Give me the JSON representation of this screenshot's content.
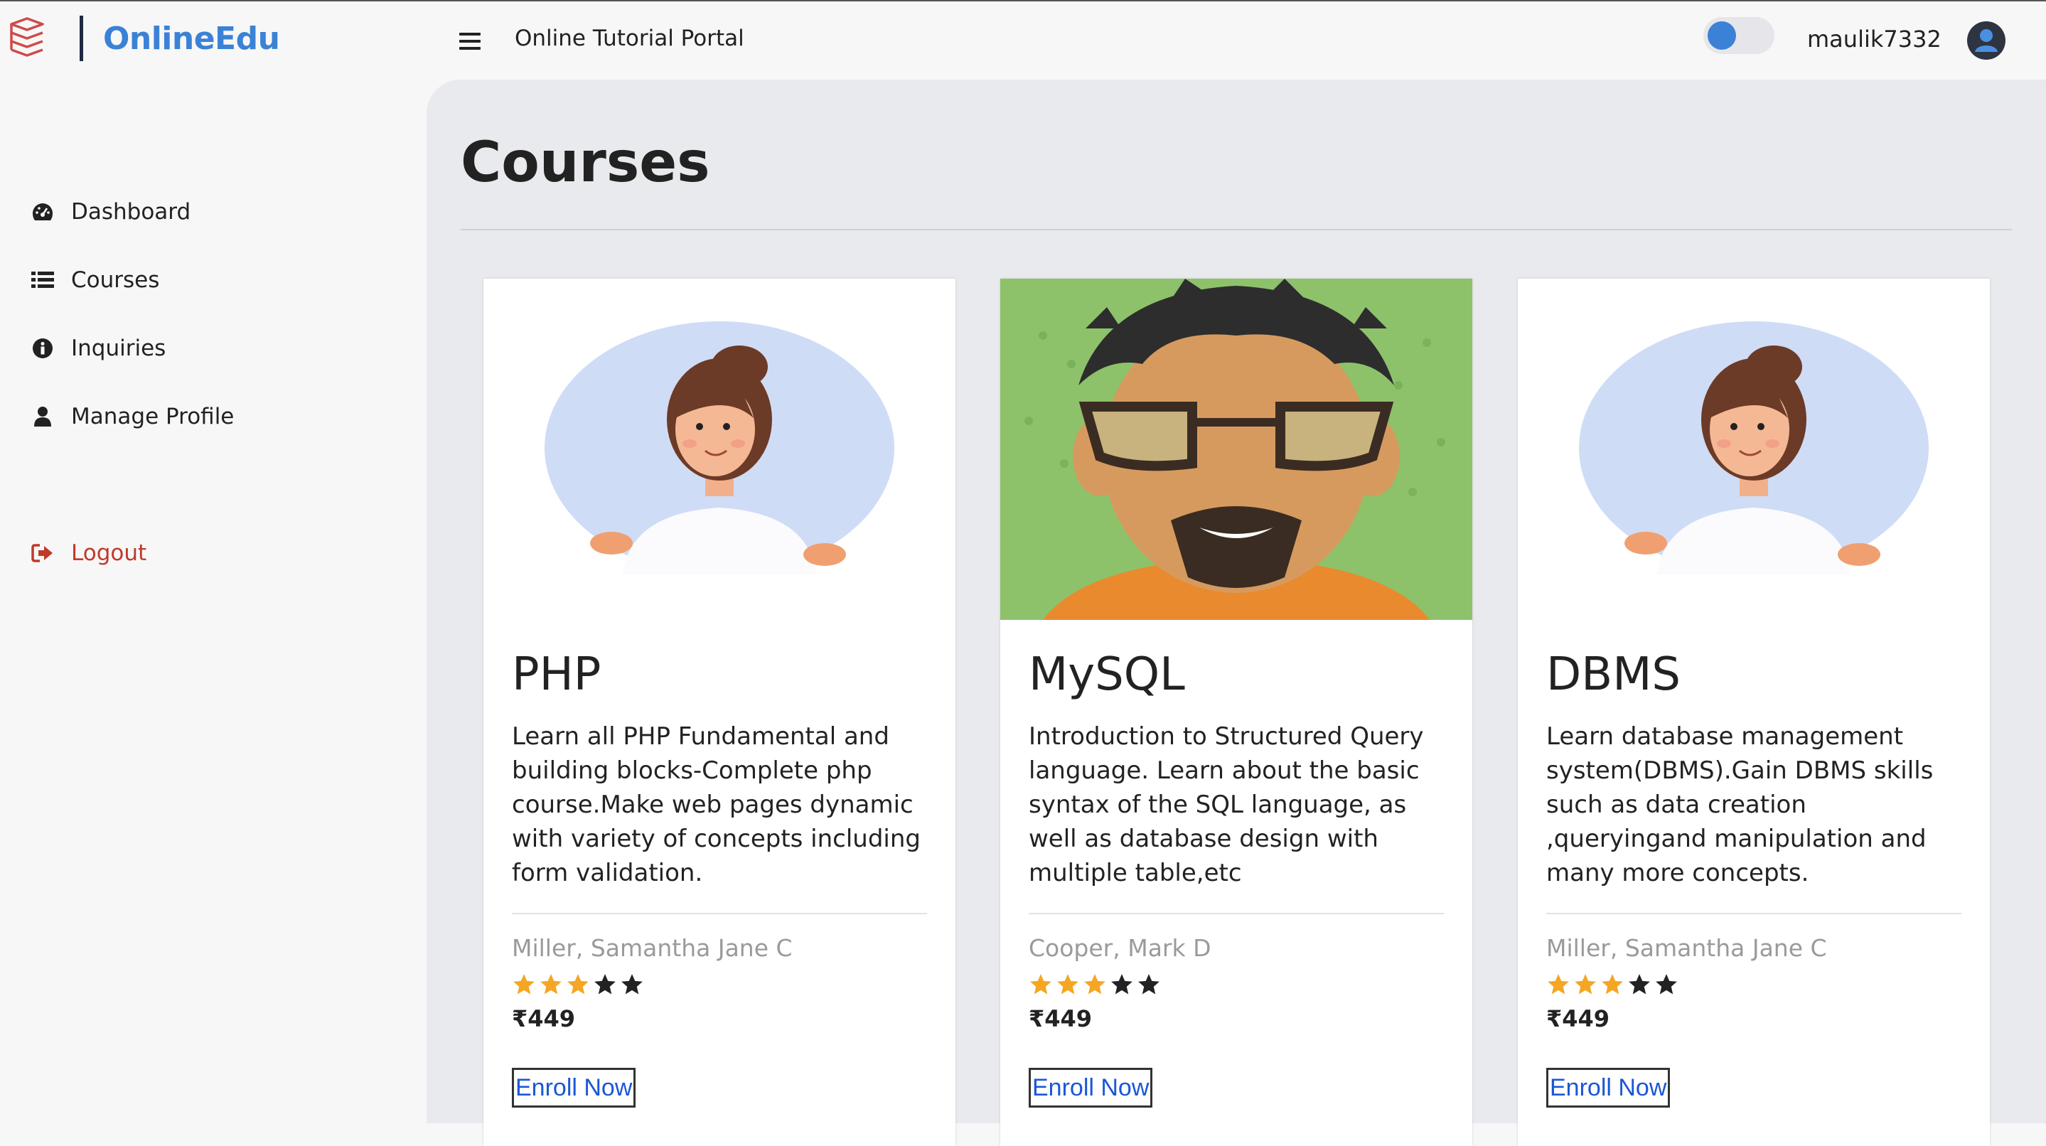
{
  "header": {
    "brand_name": "OnlineEdu",
    "portal_title": "Online Tutorial Portal",
    "username": "maulik7332",
    "accent_color": "#3b82d6"
  },
  "sidebar": {
    "items": [
      {
        "label": "Dashboard",
        "icon": "dashboard-gauge-icon"
      },
      {
        "label": "Courses",
        "icon": "list-icon"
      },
      {
        "label": "Inquiries",
        "icon": "info-circle-icon"
      },
      {
        "label": "Manage Profile",
        "icon": "user-icon"
      }
    ],
    "logout": {
      "label": "Logout",
      "icon": "sign-out-icon",
      "color": "#c0392b"
    }
  },
  "main": {
    "title": "Courses",
    "courses": [
      {
        "title": "PHP",
        "description": "Learn all PHP Fundamental and building blocks-Complete php course.Make web pages dynamic with variety of concepts including form validation.",
        "author": "Miller, Samantha Jane C",
        "rating": 3,
        "max_rating": 5,
        "price": "₹449",
        "enroll_label": "Enroll Now",
        "image": "female-avatar-illustration"
      },
      {
        "title": "MySQL",
        "description": "Introduction to Structured Query language. Learn about the basic syntax of the SQL language, as well as database design with multiple table,etc",
        "author": "Cooper, Mark D",
        "rating": 3,
        "max_rating": 5,
        "price": "₹449",
        "enroll_label": "Enroll Now",
        "image": "male-avatar-illustration"
      },
      {
        "title": "DBMS",
        "description": "Learn database management system(DBMS).Gain DBMS skills such as data creation ,queryingand manipulation and many more concepts.",
        "author": "Miller, Samantha Jane C",
        "rating": 3,
        "max_rating": 5,
        "price": "₹449",
        "enroll_label": "Enroll Now",
        "image": "female-avatar-illustration"
      }
    ]
  }
}
